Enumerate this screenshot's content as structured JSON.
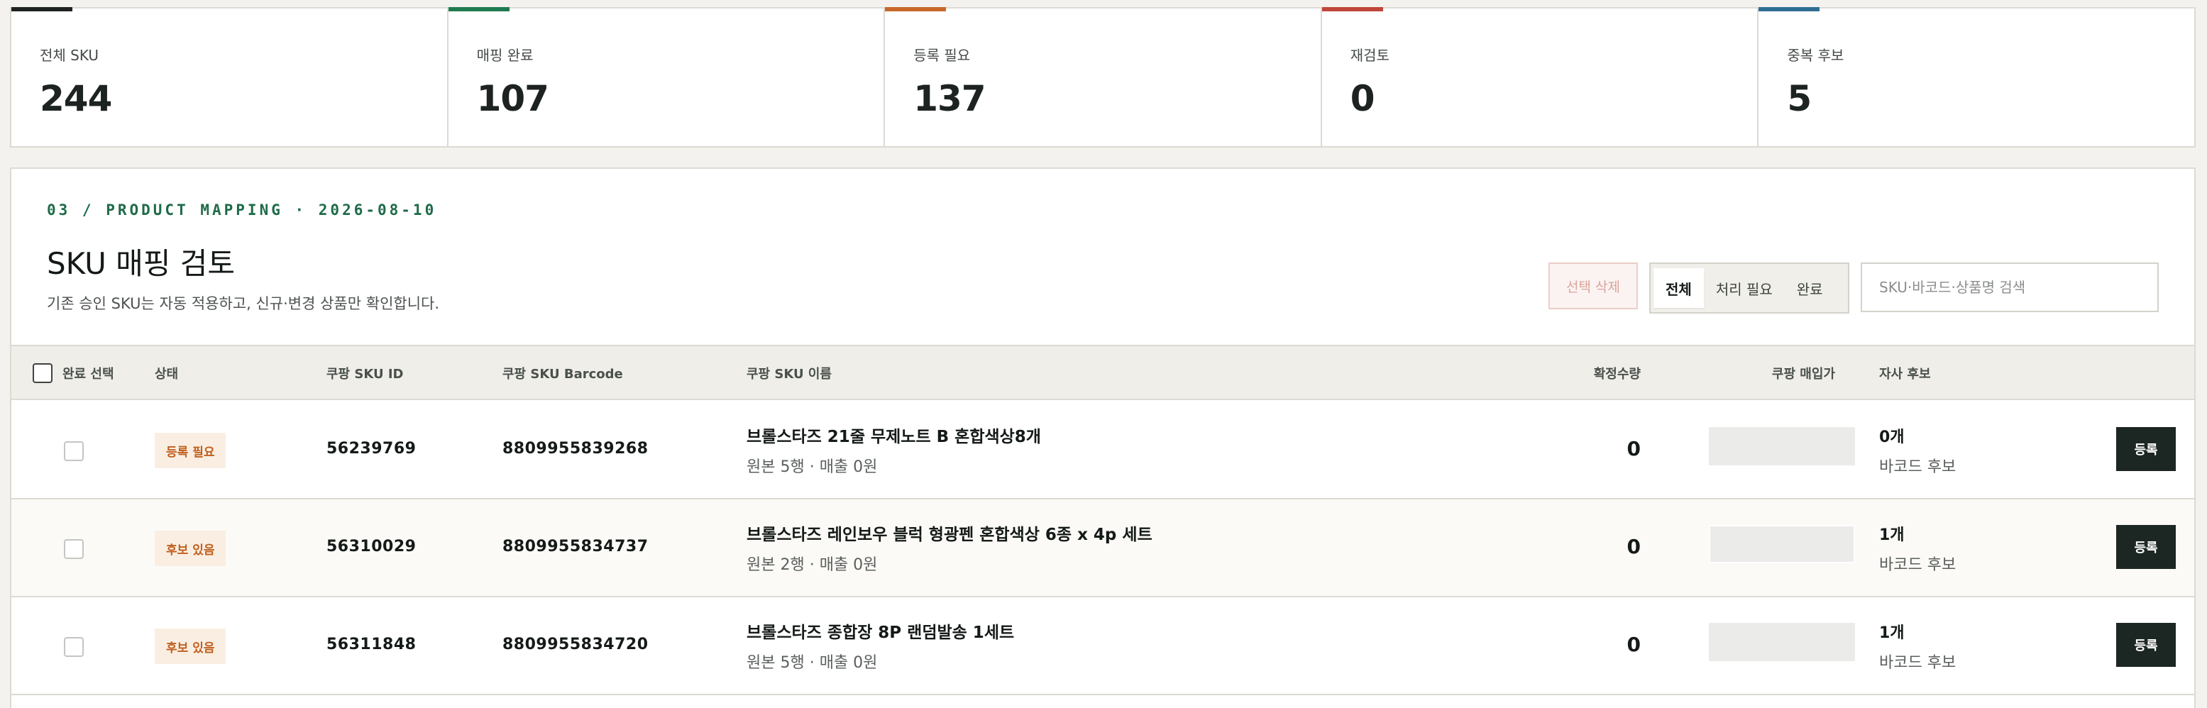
{
  "stats": [
    {
      "label": "전체 SKU",
      "value": "244",
      "color": "#1e2321"
    },
    {
      "label": "매핑 완료",
      "value": "107",
      "color": "#1f7a4f"
    },
    {
      "label": "등록 필요",
      "value": "137",
      "color": "#c8682a"
    },
    {
      "label": "재검토",
      "value": "0",
      "color": "#c0453a"
    },
    {
      "label": "중복 후보",
      "value": "5",
      "color": "#2f6e93"
    }
  ],
  "header": {
    "eyebrow": "03 / PRODUCT MAPPING · 2026-08-10",
    "title": "SKU 매핑 검토",
    "subtitle": "기존 승인 SKU는 자동 적용하고, 신규·변경 상품만 확인합니다."
  },
  "toolbar": {
    "delete_label": "선택 삭제",
    "filters": [
      "전체",
      "처리 필요",
      "완료"
    ],
    "active_filter": "전체",
    "search_placeholder": "SKU·바코드·상품명 검색"
  },
  "table": {
    "columns": {
      "select": "완료 선택",
      "status": "상태",
      "sku_id": "쿠팡 SKU ID",
      "barcode": "쿠팡 SKU Barcode",
      "name": "쿠팡 SKU 이름",
      "qty": "확정수량",
      "price": "쿠팡 매입가",
      "candidate": "자사 후보"
    },
    "rows": [
      {
        "status": "등록 필요",
        "sku_id": "56239769",
        "barcode": "8809955839268",
        "name": "브롤스타즈 21줄 무제노트 B 혼합색상8개",
        "meta": "원본 5행 · 매출 0원",
        "qty": "0",
        "price": "",
        "cand_count": "0개",
        "cand_label": "바코드 후보",
        "action": "등록"
      },
      {
        "status": "후보 있음",
        "sku_id": "56310029",
        "barcode": "8809955834737",
        "name": "브롤스타즈 레인보우 블럭 형광펜 혼합색상 6종 x 4p 세트",
        "meta": "원본 2행 · 매출 0원",
        "qty": "0",
        "price": "",
        "cand_count": "1개",
        "cand_label": "바코드 후보",
        "action": "등록"
      },
      {
        "status": "후보 있음",
        "sku_id": "56311848",
        "barcode": "8809955834720",
        "name": "브롤스타즈 종합장 8P 랜덤발송 1세트",
        "meta": "원본 5행 · 매출 0원",
        "qty": "0",
        "price": "",
        "cand_count": "1개",
        "cand_label": "바코드 후보",
        "action": "등록"
      }
    ]
  }
}
